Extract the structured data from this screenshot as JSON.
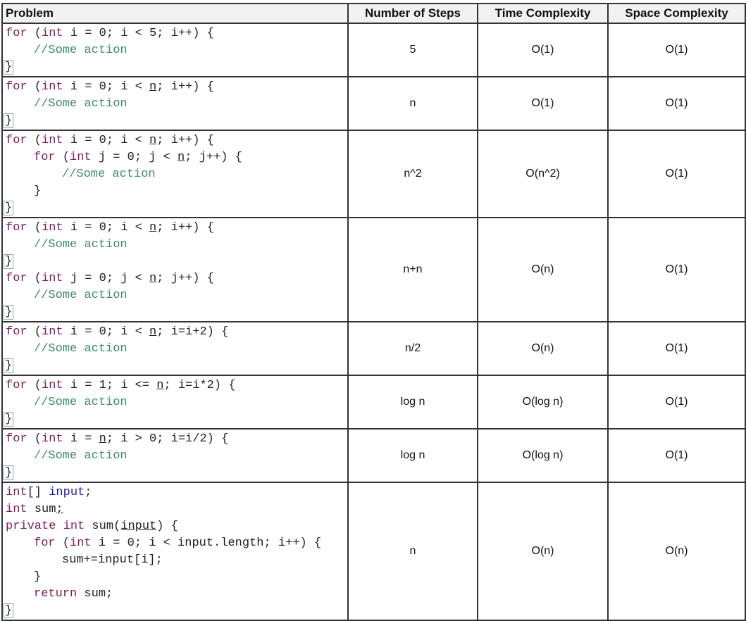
{
  "headers": [
    "Problem",
    "Number of Steps",
    "Time Complexity",
    "Space Complexity"
  ],
  "rows": [
    {
      "steps": "5",
      "time": "O(1)",
      "space": "O(1)",
      "code": [
        {
          "indent": 0,
          "parts": [
            [
              "kw",
              "for"
            ],
            [
              "pl",
              " ("
            ],
            [
              "kw",
              "int"
            ],
            [
              "pl",
              " i = 0; i < 5; i++) {"
            ]
          ]
        },
        {
          "indent": 1,
          "parts": [
            [
              "cm",
              "//Some action"
            ]
          ]
        },
        {
          "indent": 0,
          "parts": [
            [
              "br",
              "}"
            ]
          ]
        }
      ]
    },
    {
      "steps": "n",
      "time": "O(1)",
      "space": "O(1)",
      "code": [
        {
          "indent": 0,
          "parts": [
            [
              "kw",
              "for"
            ],
            [
              "pl",
              " ("
            ],
            [
              "kw",
              "int"
            ],
            [
              "pl",
              " i = 0; i < "
            ],
            [
              "u",
              "n"
            ],
            [
              "pl",
              "; i++) {"
            ]
          ]
        },
        {
          "indent": 1,
          "parts": [
            [
              "cm",
              "//Some action"
            ]
          ]
        },
        {
          "indent": 0,
          "parts": [
            [
              "br",
              "}"
            ]
          ]
        }
      ]
    },
    {
      "steps": "n^2",
      "time": "O(n^2)",
      "space": "O(1)",
      "code": [
        {
          "indent": 0,
          "parts": [
            [
              "kw",
              "for"
            ],
            [
              "pl",
              " ("
            ],
            [
              "kw",
              "int"
            ],
            [
              "pl",
              " i = 0; i < "
            ],
            [
              "u",
              "n"
            ],
            [
              "pl",
              "; i++) {"
            ]
          ]
        },
        {
          "indent": 1,
          "parts": [
            [
              "kw",
              "for"
            ],
            [
              "pl",
              " ("
            ],
            [
              "kw",
              "int"
            ],
            [
              "pl",
              " j = 0; j < "
            ],
            [
              "u",
              "n"
            ],
            [
              "pl",
              "; j++) {"
            ]
          ]
        },
        {
          "indent": 2,
          "parts": [
            [
              "cm",
              "//Some action"
            ]
          ]
        },
        {
          "indent": 1,
          "parts": [
            [
              "pl",
              "}"
            ]
          ]
        },
        {
          "indent": 0,
          "parts": [
            [
              "br",
              "}"
            ]
          ]
        }
      ]
    },
    {
      "steps": "n+n",
      "time": "O(n)",
      "space": "O(1)",
      "code": [
        {
          "indent": 0,
          "parts": [
            [
              "kw",
              "for"
            ],
            [
              "pl",
              " ("
            ],
            [
              "kw",
              "int"
            ],
            [
              "pl",
              " i = 0; i < "
            ],
            [
              "u",
              "n"
            ],
            [
              "pl",
              "; i++) {"
            ]
          ]
        },
        {
          "indent": 1,
          "parts": [
            [
              "cm",
              "//Some action"
            ]
          ]
        },
        {
          "indent": 0,
          "parts": [
            [
              "br",
              "}"
            ]
          ]
        },
        {
          "indent": 0,
          "parts": [
            [
              "kw",
              "for"
            ],
            [
              "pl",
              " ("
            ],
            [
              "kw",
              "int"
            ],
            [
              "pl",
              " j = 0; j < "
            ],
            [
              "u",
              "n"
            ],
            [
              "pl",
              "; j++) {"
            ]
          ]
        },
        {
          "indent": 1,
          "parts": [
            [
              "cm",
              "//Some action"
            ]
          ]
        },
        {
          "indent": 0,
          "parts": [
            [
              "br",
              "}"
            ]
          ]
        }
      ]
    },
    {
      "steps": "n/2",
      "time": "O(n)",
      "space": "O(1)",
      "code": [
        {
          "indent": 0,
          "parts": [
            [
              "kw",
              "for"
            ],
            [
              "pl",
              " ("
            ],
            [
              "kw",
              "int"
            ],
            [
              "pl",
              " i = 0; i < "
            ],
            [
              "u",
              "n"
            ],
            [
              "pl",
              "; i=i+2) {"
            ]
          ]
        },
        {
          "indent": 1,
          "parts": [
            [
              "cm",
              "//Some action"
            ]
          ]
        },
        {
          "indent": 0,
          "parts": [
            [
              "br",
              "}"
            ]
          ]
        }
      ]
    },
    {
      "steps": "log n",
      "time": "O(log n)",
      "space": "O(1)",
      "code": [
        {
          "indent": 0,
          "parts": [
            [
              "kw",
              "for"
            ],
            [
              "pl",
              " ("
            ],
            [
              "kw",
              "int"
            ],
            [
              "pl",
              " i = 1; i <= "
            ],
            [
              "u",
              "n"
            ],
            [
              "pl",
              "; i=i*2) {"
            ]
          ]
        },
        {
          "indent": 1,
          "parts": [
            [
              "cm",
              "//Some action"
            ]
          ]
        },
        {
          "indent": 0,
          "parts": [
            [
              "br",
              "}"
            ]
          ]
        }
      ]
    },
    {
      "steps": "log n",
      "time": "O(log n)",
      "space": "O(1)",
      "code": [
        {
          "indent": 0,
          "parts": [
            [
              "kw",
              "for"
            ],
            [
              "pl",
              " ("
            ],
            [
              "kw",
              "int"
            ],
            [
              "pl",
              " i = "
            ],
            [
              "u",
              "n"
            ],
            [
              "pl",
              "; i > 0; i=i/2) {"
            ]
          ]
        },
        {
          "indent": 1,
          "parts": [
            [
              "cm",
              "//Some action"
            ]
          ]
        },
        {
          "indent": 0,
          "parts": [
            [
              "br",
              "}"
            ]
          ]
        }
      ]
    },
    {
      "steps": "n",
      "time": "O(n)",
      "space": "O(n)",
      "code": [
        {
          "indent": 0,
          "parts": [
            [
              "kw",
              "int"
            ],
            [
              "pl",
              "[] "
            ],
            [
              "id",
              "input"
            ],
            [
              "pl",
              ";"
            ]
          ]
        },
        {
          "indent": 0,
          "parts": [
            [
              "kw",
              "int"
            ],
            [
              "pl",
              " sum"
            ],
            [
              "u",
              ";"
            ]
          ]
        },
        {
          "indent": 0,
          "parts": [
            [
              "kw",
              "private"
            ],
            [
              "pl",
              " "
            ],
            [
              "kw",
              "int"
            ],
            [
              "pl",
              " sum("
            ],
            [
              "u",
              "input"
            ],
            [
              "pl",
              ") {"
            ]
          ]
        },
        {
          "indent": 1,
          "parts": [
            [
              "kw",
              "for"
            ],
            [
              "pl",
              " ("
            ],
            [
              "kw",
              "int"
            ],
            [
              "pl",
              " i = 0; i < input.length; i++) {"
            ]
          ]
        },
        {
          "indent": 2,
          "parts": [
            [
              "pl",
              "sum+=input[i];"
            ]
          ]
        },
        {
          "indent": 1,
          "parts": [
            [
              "pl",
              "}"
            ]
          ]
        },
        {
          "indent": 1,
          "parts": [
            [
              "kw",
              "return"
            ],
            [
              "pl",
              " sum;"
            ]
          ]
        },
        {
          "indent": 0,
          "parts": [
            [
              "br",
              "}"
            ]
          ]
        }
      ]
    }
  ]
}
